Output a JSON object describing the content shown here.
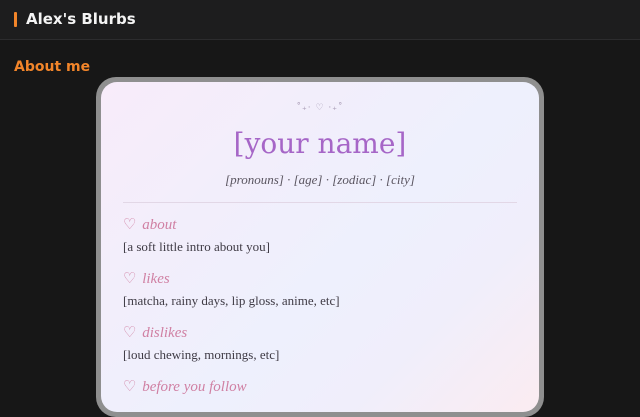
{
  "header": {
    "title": "Alex's Blurbs"
  },
  "section": {
    "title": "About me"
  },
  "card": {
    "sparkle": "˚₊‧ ♡ ‧₊˚",
    "name": "[your name]",
    "meta": "[pronouns] · [age] · [zodiac] · [city]",
    "heart_symbol": "♡",
    "sections": [
      {
        "heading": "about",
        "body": "[a soft little intro about you]"
      },
      {
        "heading": "likes",
        "body": "[matcha, rainy days, lip gloss, anime, etc]"
      },
      {
        "heading": "dislikes",
        "body": "[loud chewing, mornings, etc]"
      },
      {
        "heading": "before you follow",
        "body": ""
      }
    ]
  },
  "colors": {
    "accent": "#f2852a",
    "name": "#a666c7",
    "heading": "#d080a3"
  }
}
